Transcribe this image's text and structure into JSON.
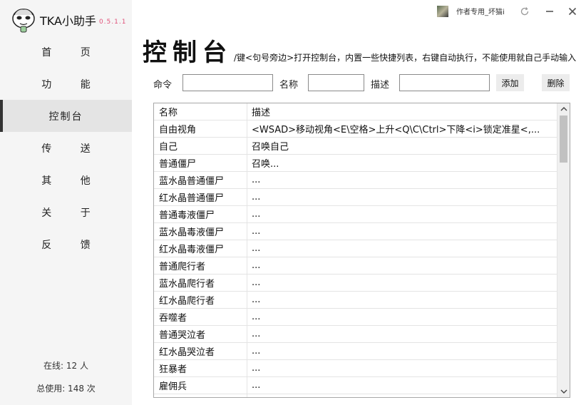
{
  "app": {
    "name": "TKA小助手",
    "version": "0.5.1.1"
  },
  "titlebar": {
    "author": "作者专用_坏猫i"
  },
  "nav": [
    "首 页",
    "功 能",
    "控制台",
    "传 送",
    "其 他",
    "关 于",
    "反 馈"
  ],
  "stats": {
    "online": "在线: 12 人",
    "total": "总使用: 148 次"
  },
  "header": {
    "title": "控制台",
    "description": "/键<句号旁边>打开控制台，内置一些快捷列表，右键自动执行，不能使用就自己手动输入"
  },
  "form": {
    "command_label": "命令",
    "name_label": "名称",
    "desc_label": "描述",
    "command_value": "",
    "name_value": "",
    "desc_value": "",
    "add_label": "添加",
    "delete_label": "删除"
  },
  "table": {
    "headers": [
      "名称",
      "描述"
    ],
    "rows": [
      [
        "自由视角",
        "<WSAD>移动视角<E\\空格>上升<Q\\C\\Ctrl>下降<i>锁定准星<,..."
      ],
      [
        "自己",
        "召唤自己"
      ],
      [
        "普通僵尸",
        "召唤..."
      ],
      [
        "蓝水晶普通僵尸",
        "..."
      ],
      [
        "红水晶普通僵尸",
        "..."
      ],
      [
        "普通毒液僵尸",
        "..."
      ],
      [
        "蓝水晶毒液僵尸",
        "..."
      ],
      [
        "红水晶毒液僵尸",
        "..."
      ],
      [
        "普通爬行者",
        "..."
      ],
      [
        "蓝水晶爬行者",
        "..."
      ],
      [
        "红水晶爬行者",
        "..."
      ],
      [
        "吞噬者",
        "..."
      ],
      [
        "普通哭泣者",
        "..."
      ],
      [
        "红水晶哭泣者",
        "..."
      ],
      [
        "狂暴者",
        "..."
      ],
      [
        "雇佣兵",
        "..."
      ],
      [
        "",
        ""
      ]
    ]
  },
  "colors": {
    "version": "#e0527a",
    "active_marker": "#333333"
  }
}
